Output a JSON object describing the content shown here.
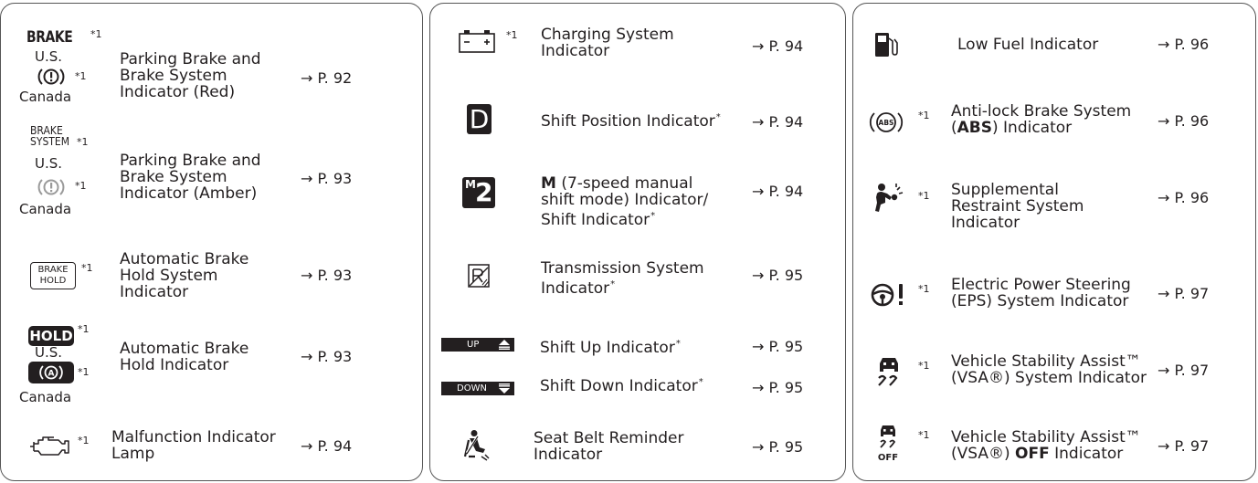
{
  "superscript": "*1",
  "colors": {
    "text": "#231f20",
    "amber_icon": "#9a9a9a",
    "border": "#555555"
  },
  "panel1": {
    "brake_red": {
      "icon_us_word": "BRAKE",
      "us_label": "U.S.",
      "canada_label": "Canada",
      "label": "Parking Brake and Brake System Indicator (Red)",
      "page": "→ P. 92"
    },
    "brake_amber": {
      "icon_us_word1": "BRAKE",
      "icon_us_word2": "SYSTEM",
      "us_label": "U.S.",
      "canada_label": "Canada",
      "label": "Parking Brake and Brake System Indicator (Amber)",
      "page": "→ P. 93"
    },
    "brake_hold_system": {
      "icon_word1": "BRAKE",
      "icon_word2": "HOLD",
      "label": "Automatic Brake Hold System Indicator",
      "page": "→ P. 93"
    },
    "brake_hold": {
      "icon_word": "HOLD",
      "us_label": "U.S.",
      "canada_label": "Canada",
      "label": "Automatic Brake Hold Indicator",
      "page": "→ P. 93"
    },
    "malfunction": {
      "label": "Malfunction Indicator Lamp",
      "page": "→ P. 94"
    }
  },
  "panel2": {
    "charging": {
      "label": "Charging System Indicator",
      "page": "→ P. 94"
    },
    "shift_position": {
      "icon_letter": "D",
      "label": "Shift Position Indicator",
      "star": "*",
      "page": "→ P. 94"
    },
    "m_mode": {
      "icon_m": "M",
      "icon_num": "2",
      "label_bold": "M",
      "label_rest": " (7-speed manual shift mode) Indicator/ Shift Indicator",
      "star": "*",
      "page": "→ P. 94"
    },
    "transmission": {
      "label": "Transmission System Indicator",
      "star": "*",
      "page": "→ P. 95"
    },
    "shift_up": {
      "icon_word": "UP",
      "label": "Shift Up Indicator",
      "star": "*",
      "page": "→ P. 95"
    },
    "shift_down": {
      "icon_word": "DOWN",
      "label": "Shift Down Indicator",
      "star": "*",
      "page": "→ P. 95"
    },
    "seat_belt": {
      "label": "Seat Belt Reminder Indicator",
      "page": "→ P. 95"
    }
  },
  "panel3": {
    "low_fuel": {
      "label": "Low Fuel Indicator",
      "page": "→ P. 96"
    },
    "abs": {
      "icon_word": "ABS",
      "label_pre": "Anti-lock Brake System (",
      "label_bold": "ABS",
      "label_post": ") Indicator",
      "page": "→ P. 96"
    },
    "srs": {
      "label": "Supplemental Restraint System Indicator",
      "page": "→ P. 96"
    },
    "eps": {
      "label": "Electric Power Steering (EPS) System Indicator",
      "page": "→ P. 97"
    },
    "vsa": {
      "label": "Vehicle Stability Assist™ (VSA®) System Indicator",
      "page": "→ P. 97"
    },
    "vsa_off": {
      "icon_word": "OFF",
      "label_pre": "Vehicle Stability Assist™ (VSA®) ",
      "label_bold": "OFF",
      "label_post": " Indicator",
      "page": "→ P. 97"
    }
  }
}
